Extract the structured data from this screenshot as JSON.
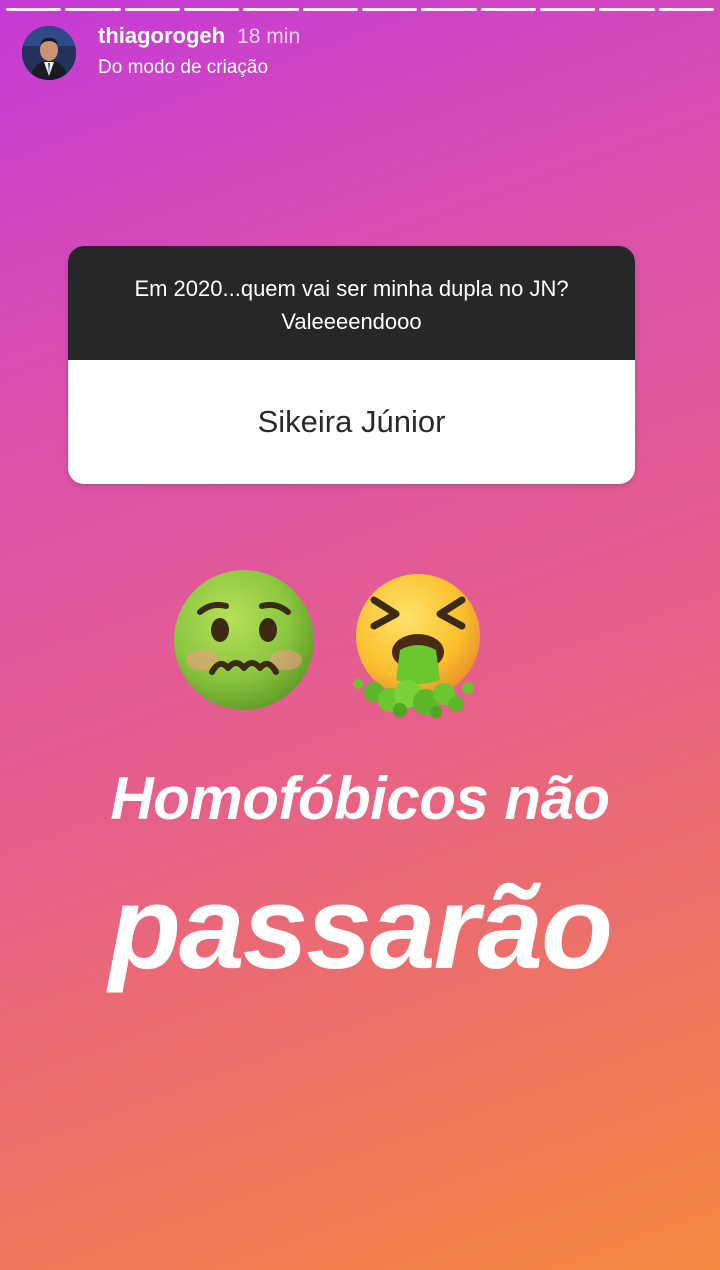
{
  "story": {
    "segments": 12,
    "username": "thiagorogeh",
    "time": "18 min",
    "subtitle": "Do modo de criação"
  },
  "question_sticker": {
    "question": "Em 2020...quem vai ser minha dupla no JN? Valeeeendooo",
    "answer": "Sikeira Júnior"
  },
  "emojis": [
    "nauseated-face",
    "face-vomiting"
  ],
  "text_lines": [
    "Homofóbicos não",
    "passarão"
  ],
  "colors": {
    "gradient_start": "#c43ad6",
    "gradient_end": "#f5893f",
    "question_bg": "#272727",
    "answer_bg": "#ffffff"
  }
}
